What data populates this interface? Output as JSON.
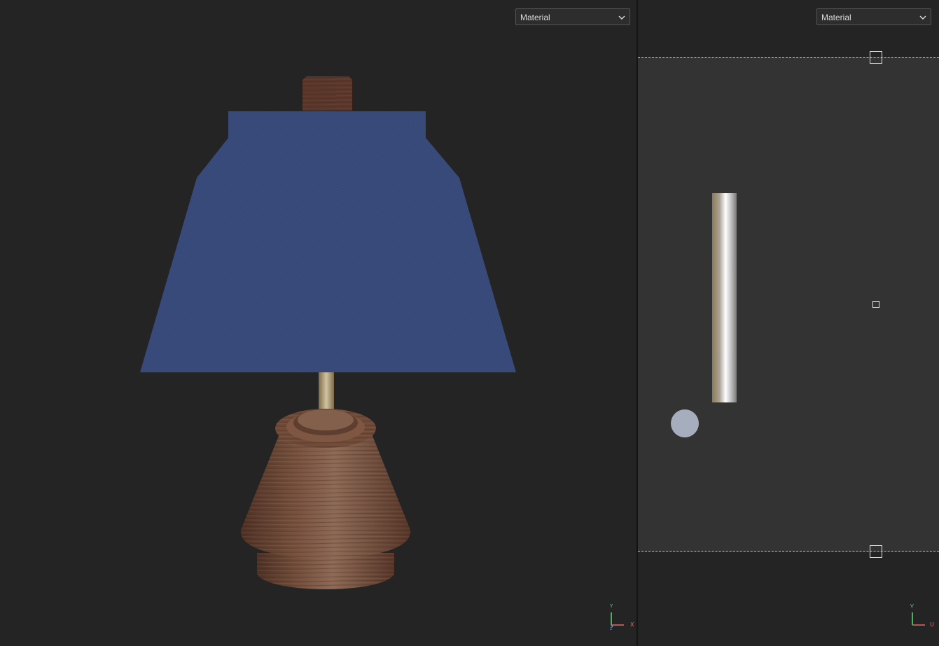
{
  "viewport_3d": {
    "mode_select": {
      "value": "Material"
    },
    "axis_gizmo": {
      "x_label": "X",
      "y_label": "Y",
      "z_label": "Z"
    },
    "colors": {
      "lampshade": "#3b4e7e",
      "wood": "#6e4a37",
      "stem": "#b7a57d",
      "background": "#242424"
    }
  },
  "viewport_uv": {
    "mode_select": {
      "value": "Material"
    },
    "axis_gizmo": {
      "v_label": "V",
      "u_label": "U"
    },
    "colors": {
      "canvas": "#333333",
      "metal": "#c8c8c8",
      "sphere": "#a6adbd"
    }
  }
}
